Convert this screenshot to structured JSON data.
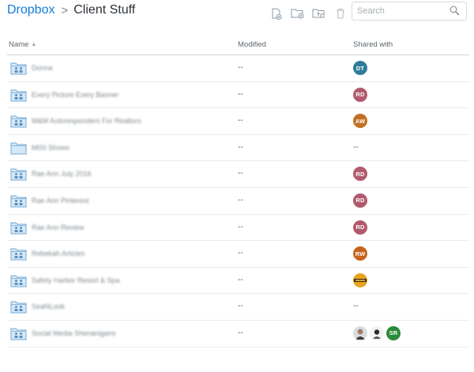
{
  "breadcrumb": {
    "root": "Dropbox",
    "separator": ">",
    "current": "Client Stuff"
  },
  "toolbar": {
    "buttons": [
      {
        "name": "new-file-button",
        "icon": "new-file-icon"
      },
      {
        "name": "new-shared-folder-button",
        "icon": "new-shared-folder-icon"
      },
      {
        "name": "upload-button",
        "icon": "upload-icon"
      },
      {
        "name": "delete-button",
        "icon": "trash-icon"
      }
    ]
  },
  "search": {
    "placeholder": "Search",
    "icon": "search-icon"
  },
  "table": {
    "columns": {
      "name": "Name",
      "modified": "Modified",
      "shared": "Shared with"
    },
    "sort": {
      "column": "name",
      "direction": "asc",
      "icon": "sort-up-arrow-icon"
    },
    "rows": [
      {
        "name": "Donna",
        "folder": "shared",
        "modified": "--",
        "shared": [
          {
            "initials": "DT",
            "color": "#2e7d99"
          }
        ],
        "shared_text": ""
      },
      {
        "name": "Every Picture Every Banner",
        "folder": "shared",
        "modified": "--",
        "shared": [
          {
            "initials": "RD",
            "color": "#b2596d"
          }
        ],
        "shared_text": ""
      },
      {
        "name": "M&M Autoresponders For Realtors",
        "folder": "shared",
        "modified": "--",
        "shared": [
          {
            "initials": "AW",
            "color": "#c27023"
          }
        ],
        "shared_text": ""
      },
      {
        "name": "MISI Shows",
        "folder": "plain",
        "modified": "--",
        "shared": [],
        "shared_text": "--"
      },
      {
        "name": "Rae Ann July 2016",
        "folder": "shared",
        "modified": "--",
        "shared": [
          {
            "initials": "RD",
            "color": "#b2596d"
          }
        ],
        "shared_text": ""
      },
      {
        "name": "Rae Ann Pinterest",
        "folder": "shared",
        "modified": "--",
        "shared": [
          {
            "initials": "RD",
            "color": "#b2596d"
          }
        ],
        "shared_text": ""
      },
      {
        "name": "Rae Ann Review",
        "folder": "shared",
        "modified": "--",
        "shared": [
          {
            "initials": "RD",
            "color": "#b2596d"
          }
        ],
        "shared_text": ""
      },
      {
        "name": "Rebekah Articles",
        "folder": "shared",
        "modified": "--",
        "shared": [
          {
            "initials": "RW",
            "color": "#c6621c"
          }
        ],
        "shared_text": ""
      },
      {
        "name": "Safety Harbor Resort & Spa",
        "folder": "shared",
        "modified": "--",
        "shared": [
          {
            "photo": "logo-avatar"
          }
        ],
        "shared_text": ""
      },
      {
        "name": "SeaNLook",
        "folder": "shared",
        "modified": "--",
        "shared": [],
        "shared_text": "--"
      },
      {
        "name": "Social Media Shenanigans",
        "folder": "shared",
        "modified": "--",
        "shared": [
          {
            "photo": "person-photo-1"
          },
          {
            "photo": "person-photo-2"
          },
          {
            "initials": "SR",
            "color": "#2a8a3a"
          }
        ],
        "shared_text": ""
      }
    ]
  },
  "colors": {
    "accent": "#0f7dd8",
    "folder_fill": "#d5e8f7",
    "folder_stroke": "#74a8d6"
  }
}
